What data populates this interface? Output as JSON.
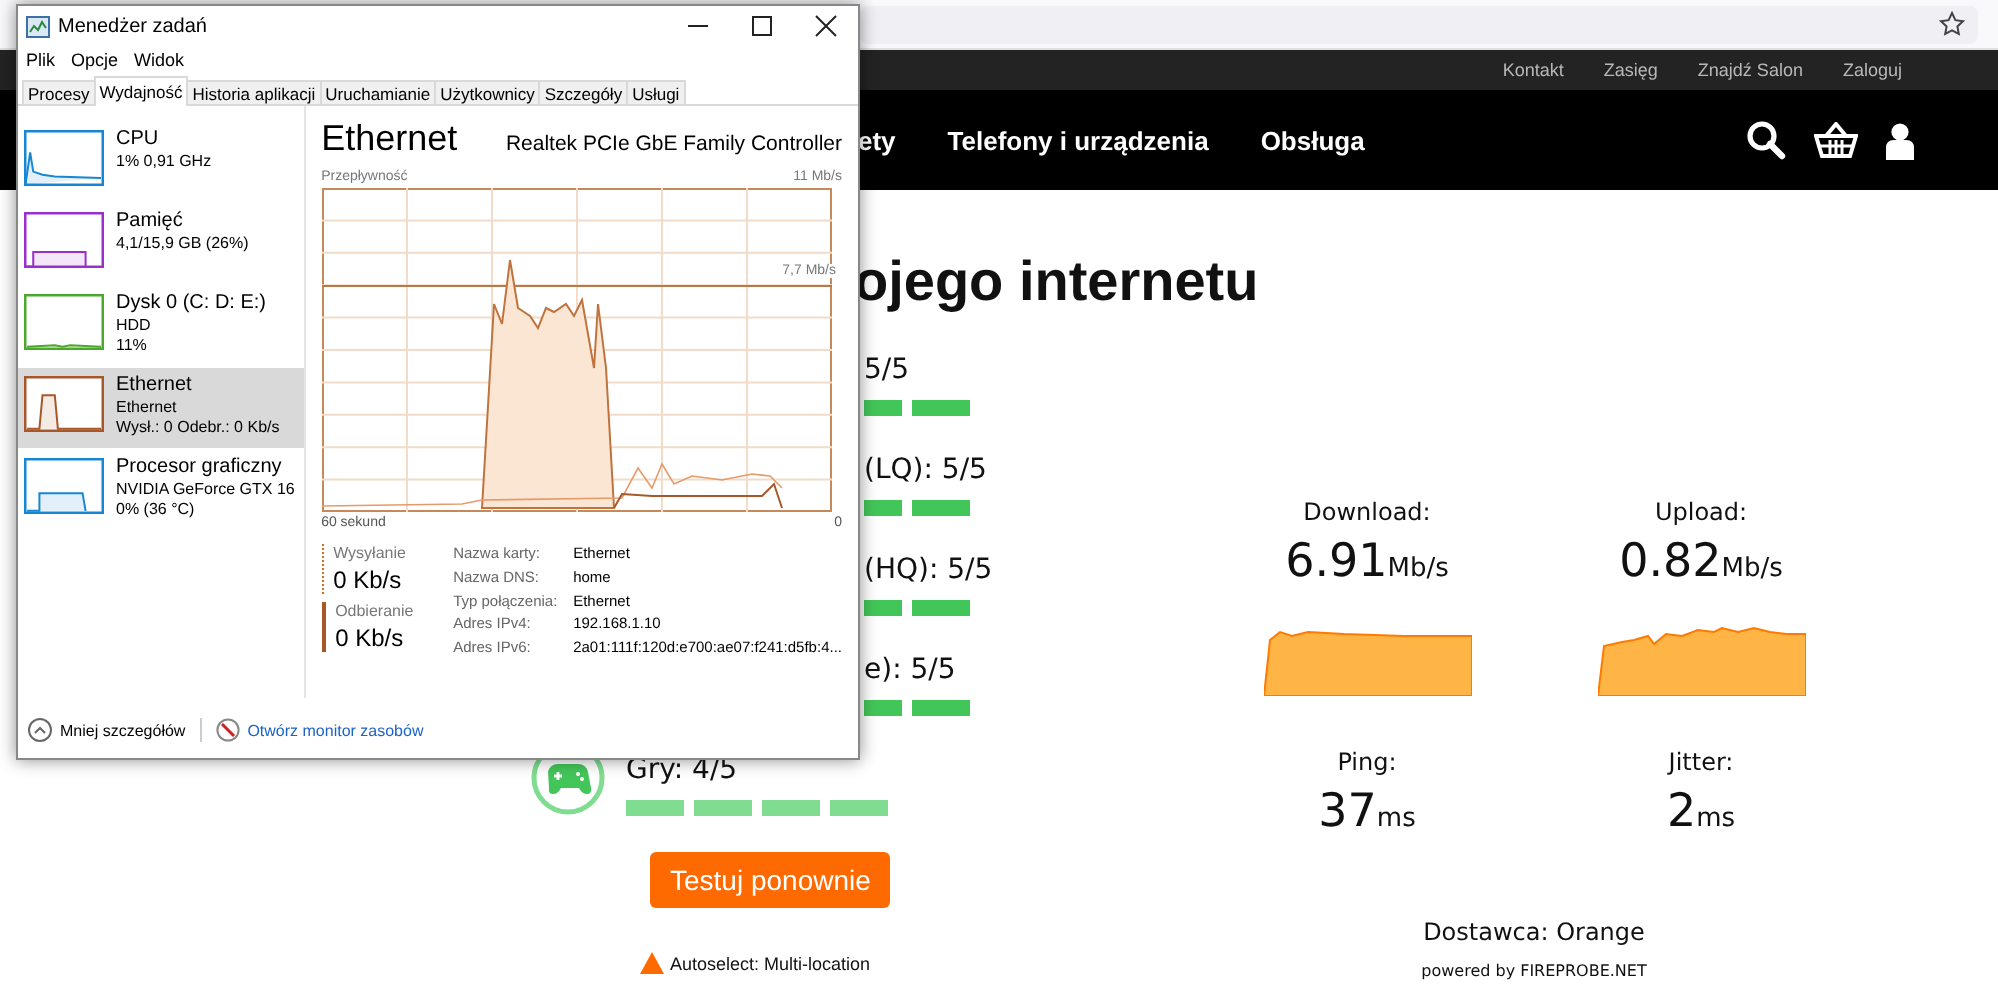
{
  "site": {
    "top_links": [
      "Kontakt",
      "Zasięg",
      "Znajdź Salon",
      "Zaloguj"
    ],
    "nav": [
      "ety",
      "Telefony i urządzenia",
      "Obsługa"
    ],
    "heading": "ojego internetu",
    "ratings": [
      {
        "label": "5/5",
        "kind": "partial"
      },
      {
        "label": "(LQ): 5/5",
        "kind": "partial"
      },
      {
        "label": "(HQ): 5/5",
        "kind": "partial"
      },
      {
        "label": "e): 5/5",
        "kind": "partial"
      },
      {
        "label": "Gry: 4/5",
        "kind": "full",
        "stars": 4
      }
    ],
    "retest_button": "Testuj ponownie",
    "server": "Autoselect: Multi-location",
    "results": [
      {
        "label": "Download:",
        "value": "6.91",
        "unit": "Mb/s",
        "kind": "speed"
      },
      {
        "label": "Upload:",
        "value": "0.82",
        "unit": "Mb/s",
        "kind": "speed"
      },
      {
        "label": "Ping:",
        "value": "37",
        "unit": "ms",
        "kind": "latency"
      },
      {
        "label": "Jitter:",
        "value": "2",
        "unit": "ms",
        "kind": "latency"
      }
    ],
    "provider": "Dostawca: Orange",
    "powered": {
      "text": "powered by",
      "link": "FIREPROBE.NET"
    }
  },
  "task_manager": {
    "title": "Menedżer zadań",
    "menu": [
      "Plik",
      "Opcje",
      "Widok"
    ],
    "tabs": [
      {
        "label": "Procesy",
        "selected": false
      },
      {
        "label": "Wydajność",
        "selected": true
      },
      {
        "label": "Historia aplikacji",
        "selected": false
      },
      {
        "label": "Uruchamianie",
        "selected": false
      },
      {
        "label": "Użytkownicy",
        "selected": false
      },
      {
        "label": "Szczegóły",
        "selected": false
      },
      {
        "label": "Usługi",
        "selected": false
      }
    ],
    "devices": [
      {
        "name": "CPU",
        "lines": [
          "1% 0,91 GHz"
        ],
        "color": "#1787d4",
        "selected": false
      },
      {
        "name": "Pamięć",
        "lines": [
          "4,1/15,9 GB (26%)"
        ],
        "color": "#9b2fc9",
        "selected": false
      },
      {
        "name": "Dysk 0 (C: D: E:)",
        "lines": [
          "HDD",
          "11%"
        ],
        "color": "#4ca82c",
        "selected": false
      },
      {
        "name": "Ethernet",
        "lines": [
          "Ethernet",
          "Wysł.: 0 Odebr.: 0 Kb/s"
        ],
        "color": "#a7582a",
        "selected": true
      },
      {
        "name": "Procesor graficzny",
        "lines": [
          "NVIDIA GeForce GTX 16",
          "0% (36 °C)"
        ],
        "color": "#1787d4",
        "selected": false
      }
    ],
    "detail": {
      "title": "Ethernet",
      "adapter": "Realtek PCIe GbE Family Controller",
      "graph_label": "Przepływność",
      "max": "11 Mb/s",
      "marker": "7,7 Mb/s",
      "time_label": "60 sekund",
      "zero": "0",
      "send": {
        "label": "Wysyłanie",
        "value": "0 Kb/s"
      },
      "receive": {
        "label": "Odbieranie",
        "value": "0 Kb/s"
      },
      "properties": [
        {
          "key": "Nazwa karty:",
          "value": "Ethernet"
        },
        {
          "key": "Nazwa DNS:",
          "value": "home"
        },
        {
          "key": "Typ połączenia:",
          "value": "Ethernet"
        },
        {
          "key": "Adres IPv4:",
          "value": "192.168.1.10"
        },
        {
          "key": "Adres IPv6:",
          "value": "2a01:111f:120d:e700:ae07:f241:d5fb:4..."
        }
      ]
    },
    "footer": {
      "less": "Mniej szczegółów",
      "monitor": "Otwórz monitor zasobów"
    }
  }
}
